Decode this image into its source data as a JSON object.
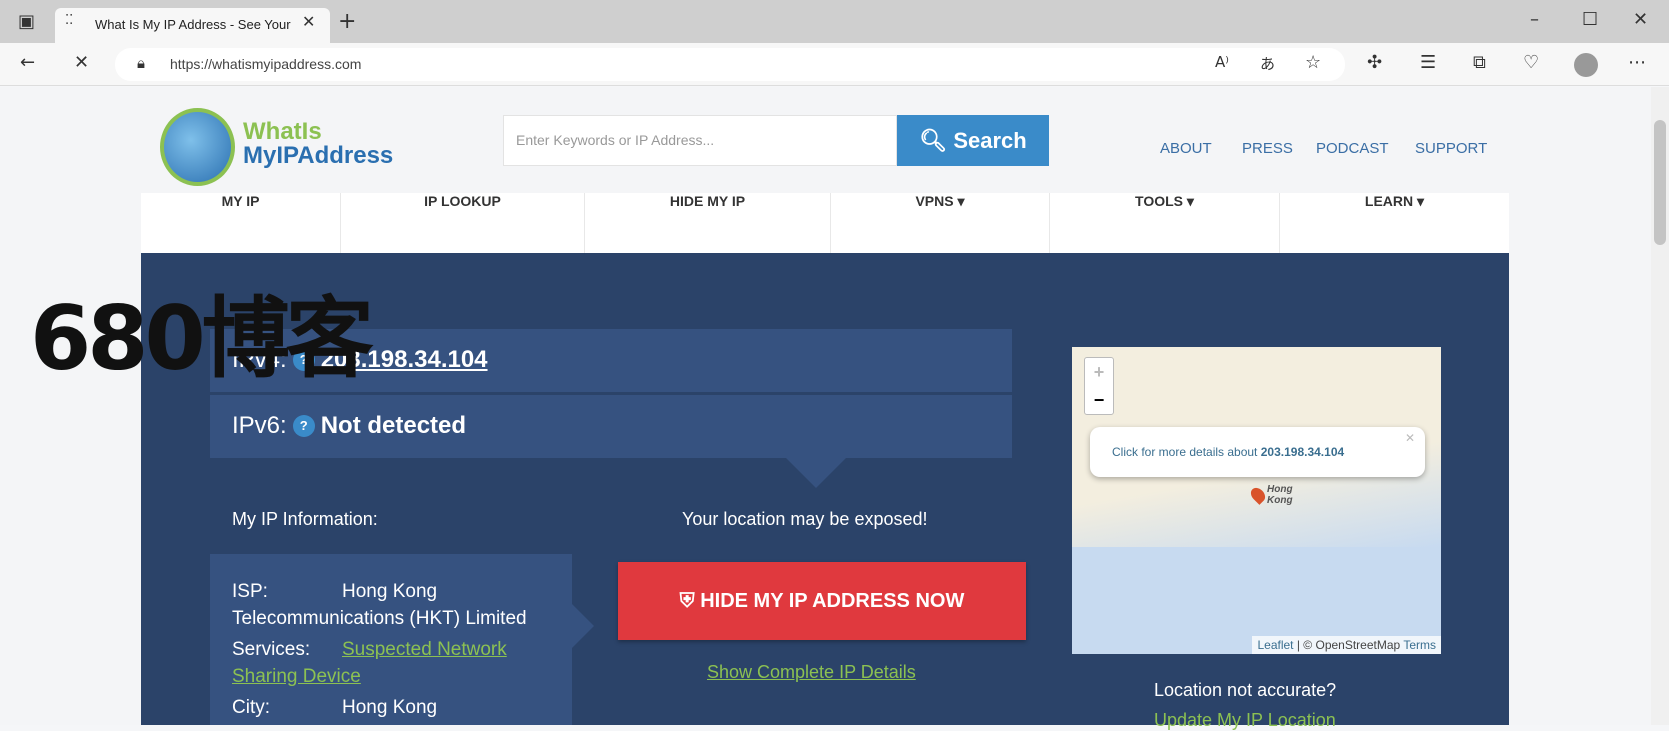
{
  "browser": {
    "tab_title": "What Is My IP Address - See Your",
    "url": "https://whatismyipaddress.com"
  },
  "header": {
    "logo_text": "WhatIsMyIPAddress.com",
    "search_placeholder": "Enter Keywords or IP Address...",
    "search_button": "Search",
    "top_links": [
      "ABOUT",
      "PRESS",
      "PODCAST",
      "SUPPORT"
    ]
  },
  "nav": [
    {
      "label": "MY IP"
    },
    {
      "label": "IP LOOKUP"
    },
    {
      "label": "HIDE MY IP"
    },
    {
      "label": "VPNS ▾"
    },
    {
      "label": "TOOLS ▾"
    },
    {
      "label": "LEARN ▾"
    }
  ],
  "ip": {
    "v4_label": "IPv4:",
    "v4_value": "203.198.34.104",
    "v6_label": "IPv6:",
    "v6_value": "Not detected"
  },
  "info": {
    "heading": "My IP Information:",
    "isp_label": "ISP:",
    "isp_value": "Hong Kong Telecommunications (HKT) Limited",
    "services_label": "Services:",
    "services_value": "Suspected Network Sharing Device",
    "city_label": "City:",
    "city_value": "Hong Kong"
  },
  "cta": {
    "warning": "Your location may be exposed!",
    "button": "HIDE MY IP ADDRESS NOW",
    "details_link": "Show Complete IP Details"
  },
  "map": {
    "popup_prefix": "Click for more details about",
    "popup_ip": "203.198.34.104",
    "label": "Hong Kong",
    "zoom_in": "+",
    "zoom_out": "−",
    "attribution_leaflet": "Leaflet",
    "attribution_osm": "| © OpenStreetMap",
    "attribution_terms": "Terms"
  },
  "location": {
    "question": "Location not accurate?",
    "link": "Update My IP Location"
  },
  "watermark": "680博客",
  "colors": {
    "panel": "#2b4369",
    "accent": "#3a8bc9",
    "cta": "#e0393e",
    "link": "#8cc152"
  }
}
